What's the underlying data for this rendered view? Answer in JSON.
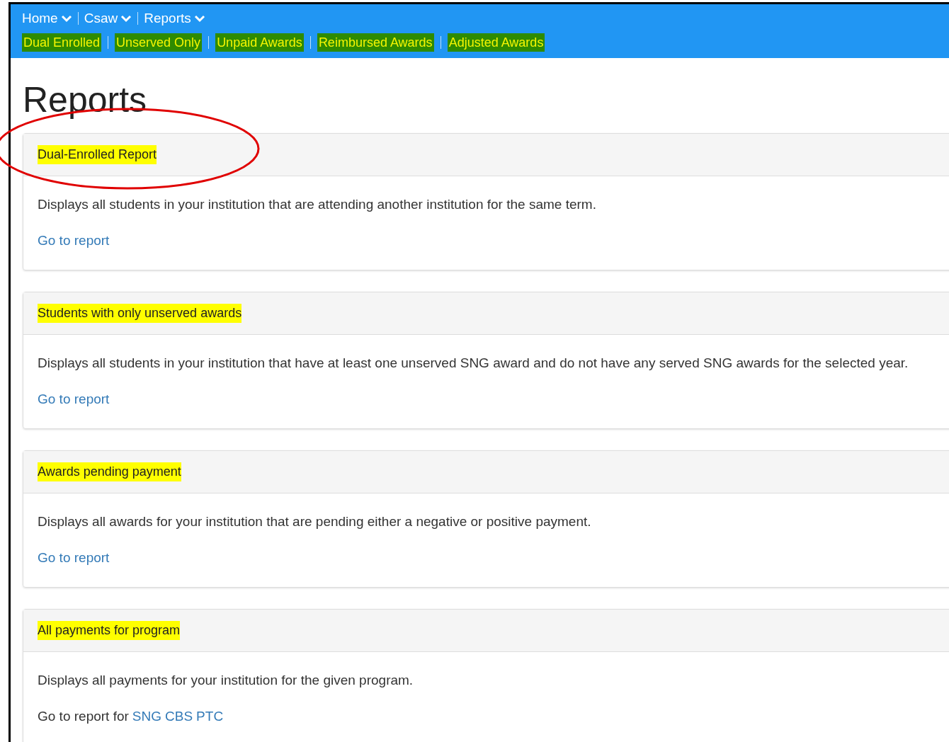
{
  "nav": {
    "menus": [
      {
        "label": "Home"
      },
      {
        "label": "Csaw"
      },
      {
        "label": "Reports"
      }
    ],
    "links": [
      {
        "label": "Dual Enrolled"
      },
      {
        "label": "Unserved Only"
      },
      {
        "label": "Unpaid Awards"
      },
      {
        "label": "Reimbursed Awards"
      },
      {
        "label": "Adjusted Awards"
      }
    ]
  },
  "page_title": "Reports",
  "panels": [
    {
      "heading": "Dual-Enrolled Report",
      "circled": true,
      "description": "Displays all students in your institution that are attending another institution for the same term.",
      "kind": "link",
      "link": "Go to report"
    },
    {
      "heading": "Students with only unserved awards",
      "circled": false,
      "description": "Displays all students in your institution that have at least one unserved SNG award and do not have any served SNG awards for the selected year.",
      "kind": "link",
      "link": "Go to report"
    },
    {
      "heading": "Awards pending payment",
      "circled": false,
      "description": "Displays all awards for your institution that are pending either a negative or positive payment.",
      "kind": "link",
      "link": "Go to report"
    },
    {
      "heading": "All payments for program",
      "circled": false,
      "description": "Displays all payments for your institution for the given program.",
      "kind": "programs",
      "prefix": "Go to report for",
      "links": [
        "SNG",
        "CBS",
        "PTC"
      ]
    }
  ]
}
